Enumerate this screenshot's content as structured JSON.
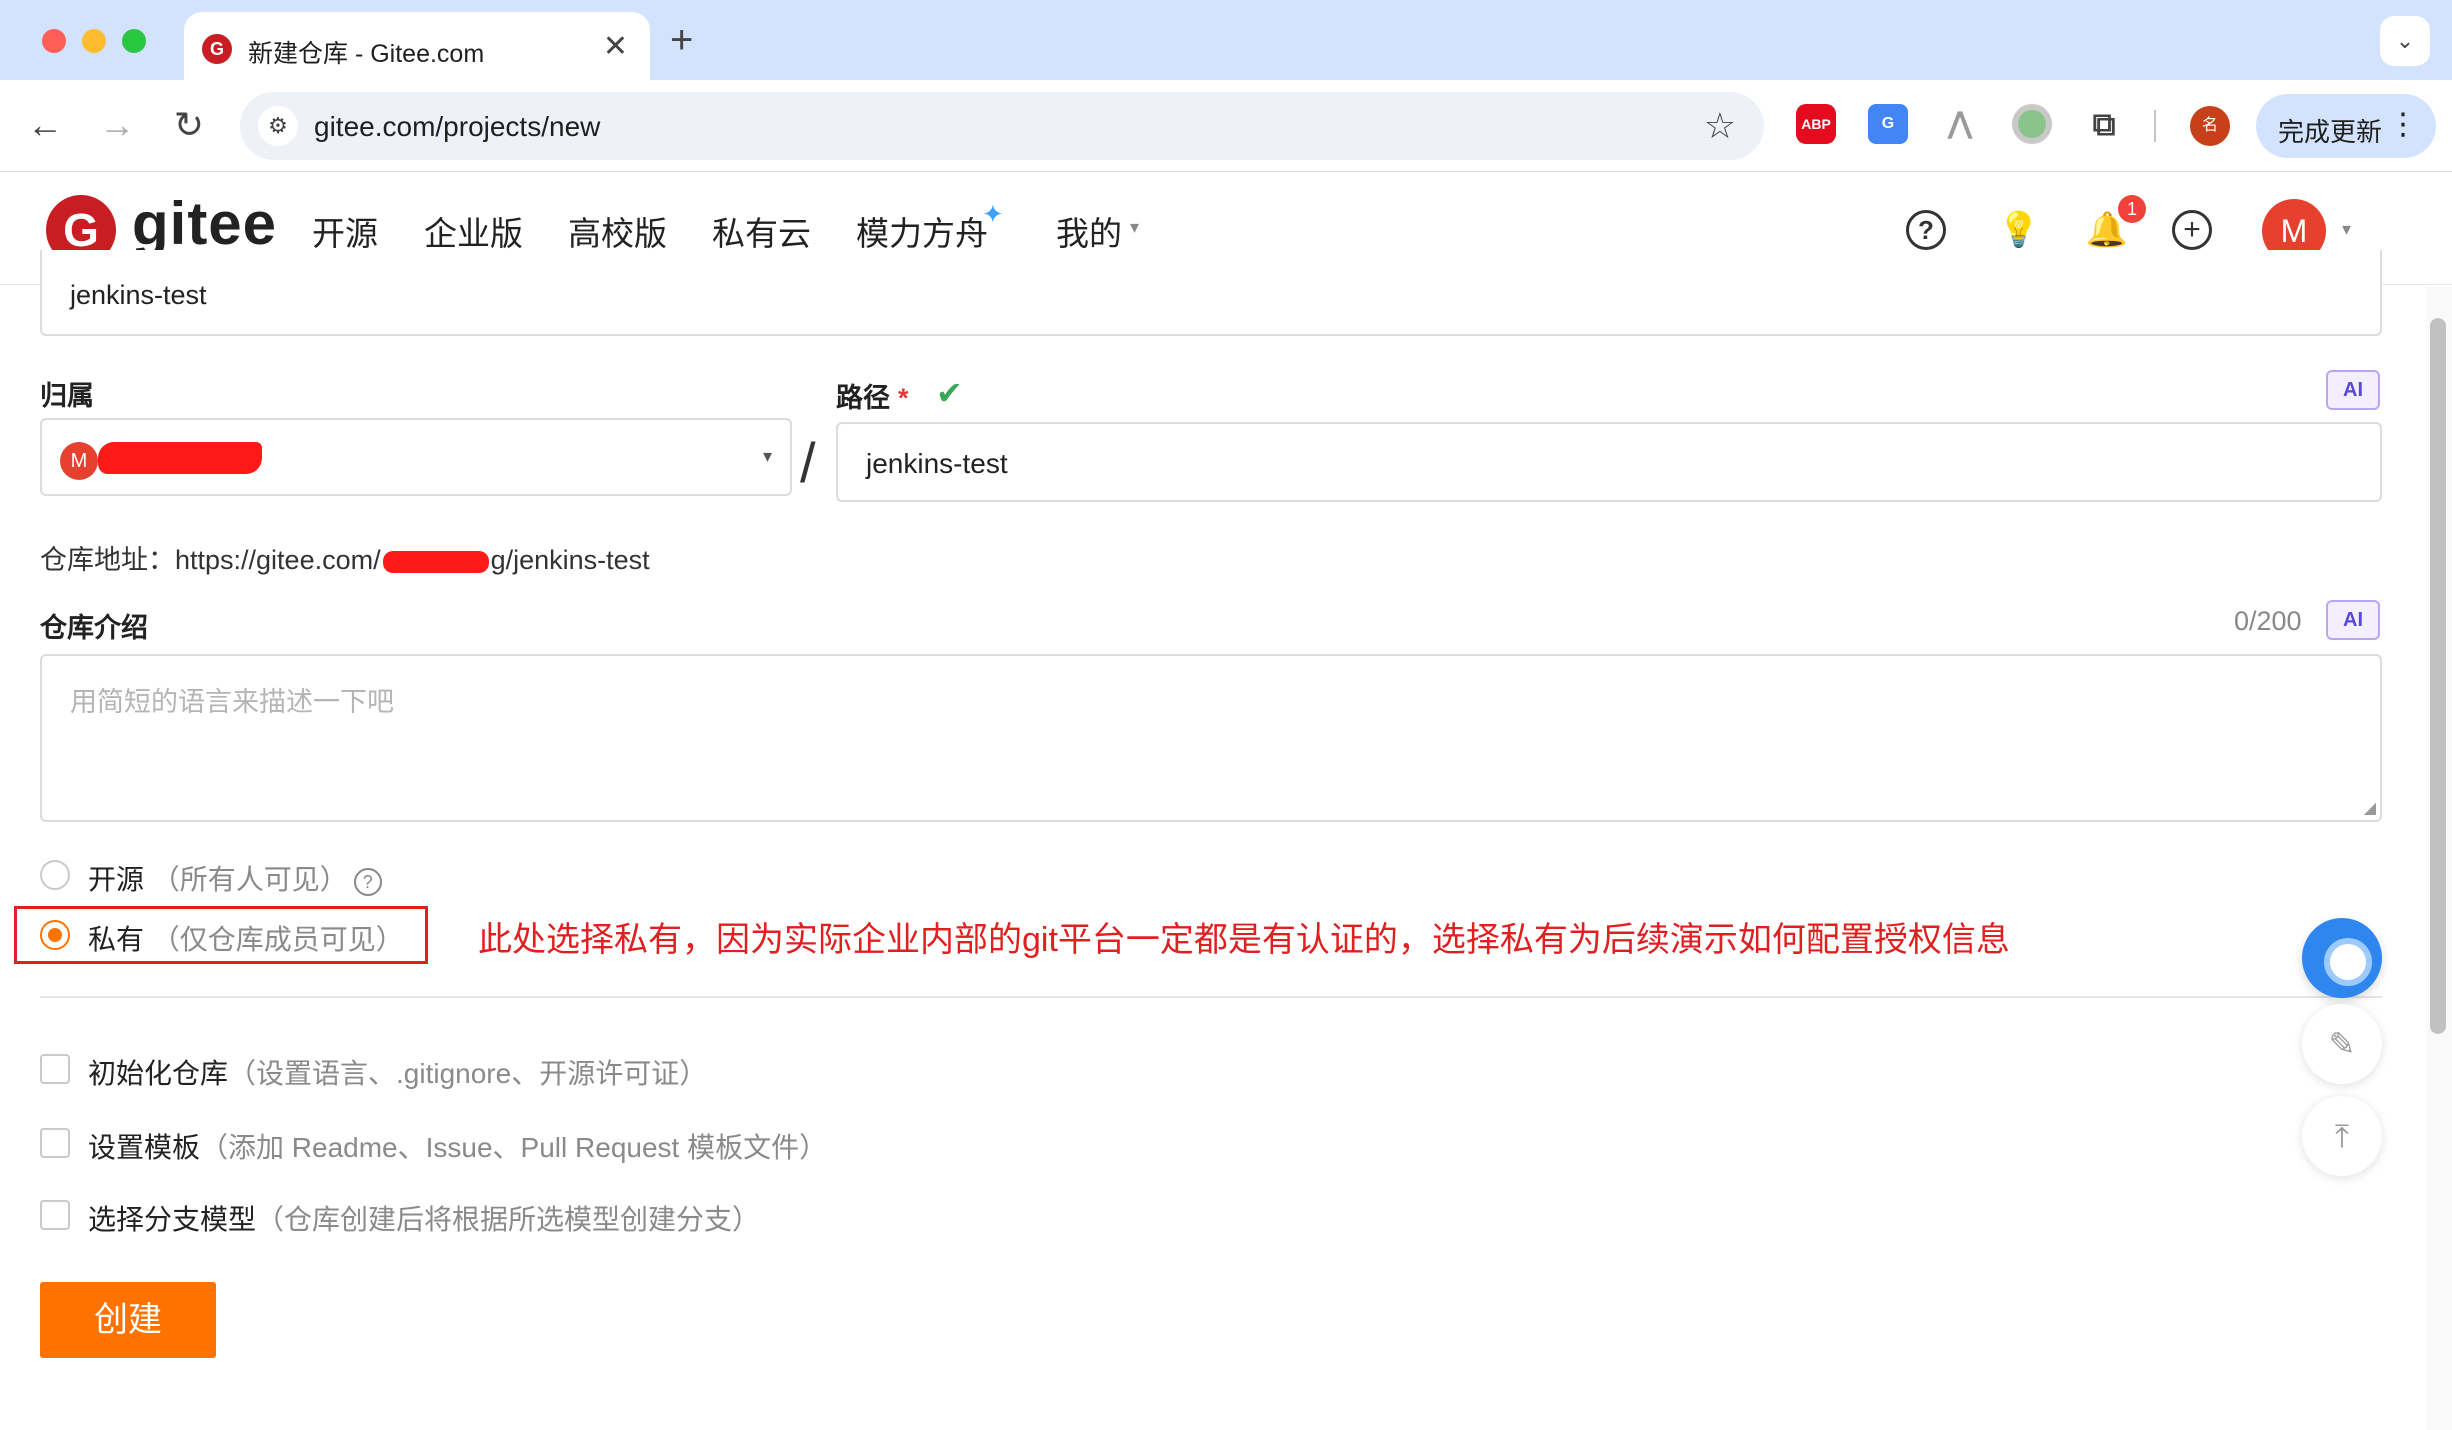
{
  "browser": {
    "tab_title": "新建仓库 - Gitee.com",
    "tab_favicon": "G",
    "tab_close": "✕",
    "new_tab": "+",
    "tab_menu": "⌄",
    "back": "←",
    "forward": "→",
    "reload": "↻",
    "site_info": "⚙",
    "url": "gitee.com/projects/new",
    "star": "☆",
    "extensions": {
      "abp": "ABP",
      "translate": "G",
      "a_icon": "⋀",
      "circle": "",
      "puzzle": "⧉"
    },
    "profile_chip": "名",
    "update_label": "完成更新",
    "update_menu": "⋮"
  },
  "header": {
    "logo_mark": "G",
    "logo_text": "gitee",
    "nav": [
      "开源",
      "企业版",
      "高校版",
      "私有云",
      "模力方舟",
      "我的"
    ],
    "sparkle": "✦",
    "caret": "▾",
    "help": "?",
    "bulb": "💡",
    "bell": "🔔",
    "notification_count": "1",
    "plus": "+",
    "avatar": "M",
    "avatar_caret": "▾"
  },
  "form": {
    "name_value": "jenkins-test",
    "owner_label": "归属",
    "owner_avatar": "M",
    "owner_caret": "▾",
    "slash": "/",
    "path_label": "路径",
    "required_mark": "*",
    "path_check": "✔",
    "ai_badge": "AI",
    "path_value": "jenkins-test",
    "repo_url_prefix": "仓库地址：https://gitee.com/",
    "repo_url_suffix": "g/jenkins-test",
    "desc_label": "仓库介绍",
    "desc_count": "0/200",
    "desc_placeholder": "用简短的语言来描述一下吧",
    "resize_grip": "◢",
    "visibility": [
      {
        "label": "开源",
        "hint": "（所有人可见）",
        "checked": false,
        "help": "?"
      },
      {
        "label": "私有",
        "hint": "（仅仓库成员可见）",
        "checked": true
      }
    ],
    "annotation": "此处选择私有，因为实际企业内部的git平台一定都是有认证的，选择私有为后续演示如何配置授权信息",
    "options": [
      {
        "label": "初始化仓库",
        "hint": "（设置语言、.gitignore、开源许可证）"
      },
      {
        "label": "设置模板",
        "hint": "（添加 Readme、Issue、Pull Request 模板文件）"
      },
      {
        "label": "选择分支模型",
        "hint": "（仓库创建后将根据所选模型创建分支）"
      }
    ],
    "create_label": "创建"
  },
  "floating": {
    "edit_icon": "✎",
    "top_icon": "⤒"
  },
  "colors": {
    "brand_red": "#c71d23",
    "accent_orange": "#fe7300",
    "annotation_red": "#e02020"
  }
}
